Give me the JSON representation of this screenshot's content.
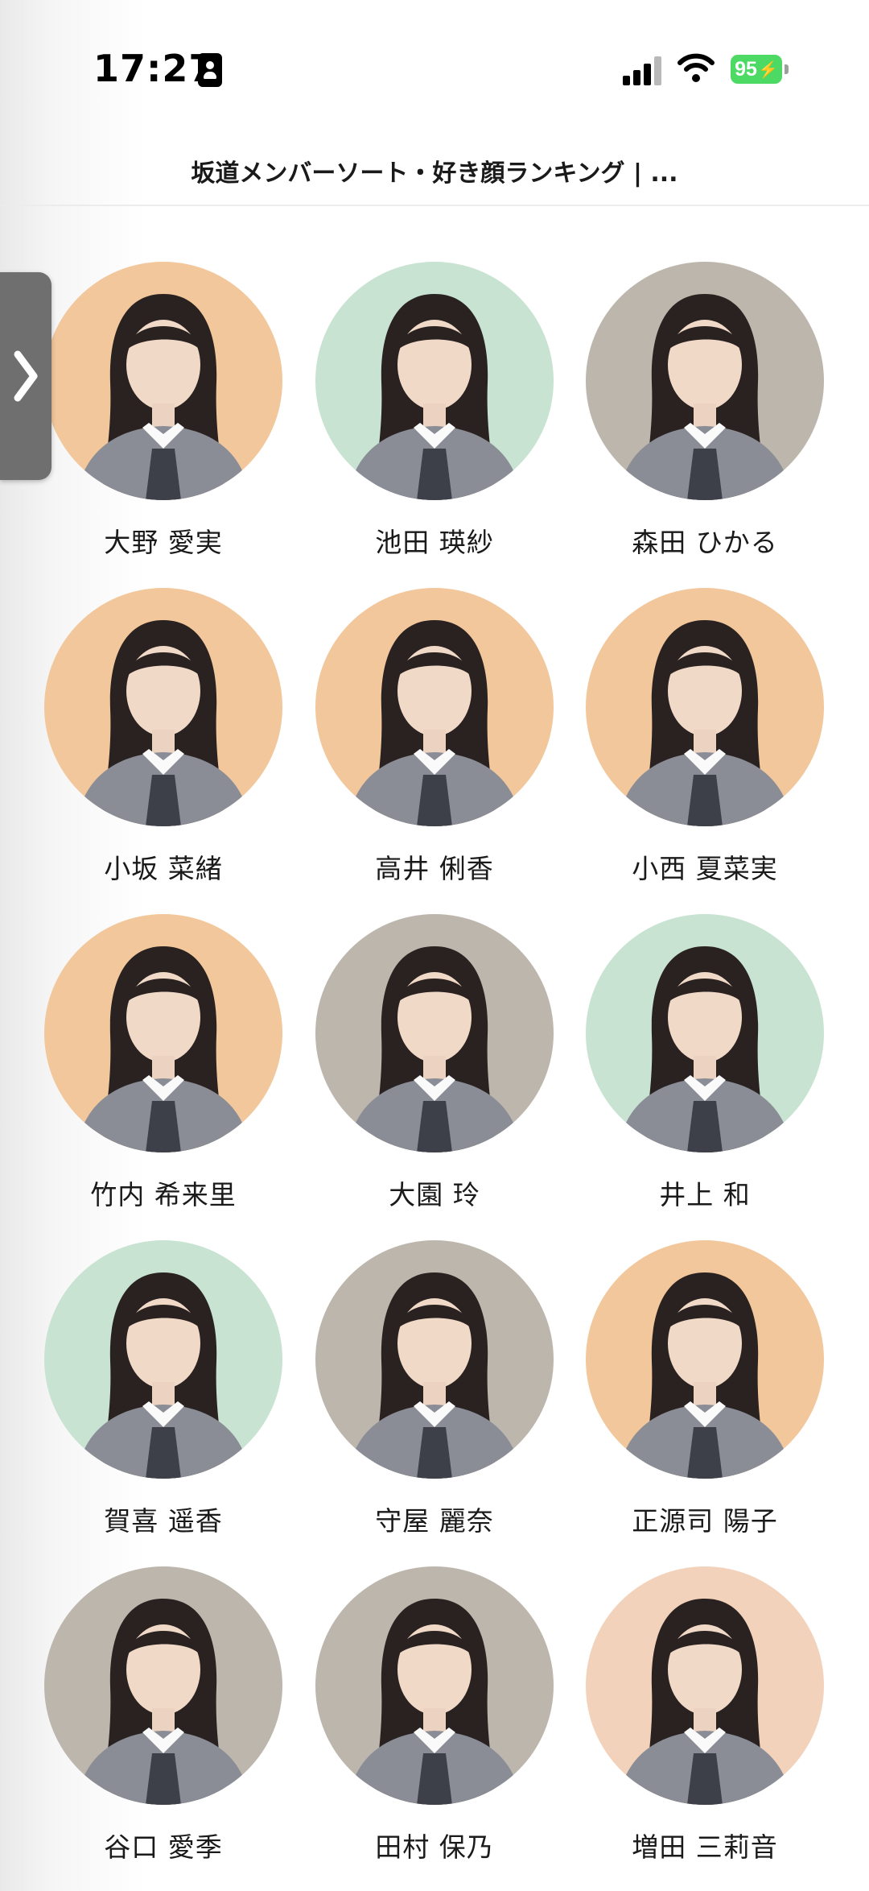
{
  "status_bar": {
    "time": "17:27",
    "battery": "95"
  },
  "page": {
    "title": "坂道メンバーソート・好き顔ランキング | ..."
  },
  "side_tab": {
    "icon": "chevron-right-icon"
  },
  "members": [
    {
      "name": "大野 愛実",
      "bg": "#f2c79b"
    },
    {
      "name": "池田 瑛紗",
      "bg": "#c8e3d2"
    },
    {
      "name": "森田 ひかる",
      "bg": "#bdb6ac"
    },
    {
      "name": "小坂 菜緒",
      "bg": "#f2c79b"
    },
    {
      "name": "高井 俐香",
      "bg": "#f2c79b"
    },
    {
      "name": "小西 夏菜実",
      "bg": "#f2c79b"
    },
    {
      "name": "竹内 希来里",
      "bg": "#f2c79b"
    },
    {
      "name": "大園 玲",
      "bg": "#bdb6ac"
    },
    {
      "name": "井上 和",
      "bg": "#c8e3d2"
    },
    {
      "name": "賀喜 遥香",
      "bg": "#c8e3d2"
    },
    {
      "name": "守屋 麗奈",
      "bg": "#bdb6ac"
    },
    {
      "name": "正源司 陽子",
      "bg": "#f2c79b"
    },
    {
      "name": "谷口 愛季",
      "bg": "#bdb6ac"
    },
    {
      "name": "田村 保乃",
      "bg": "#bdb6ac"
    },
    {
      "name": "増田 三莉音",
      "bg": "#f3d2bc"
    }
  ]
}
